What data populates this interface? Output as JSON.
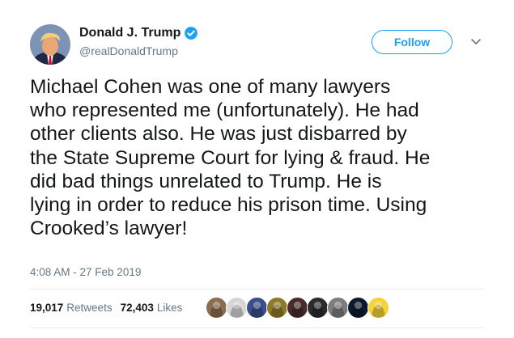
{
  "author": {
    "display_name": "Donald J. Trump",
    "handle": "@realDonaldTrump",
    "verified": true,
    "avatar_icon": "avatar-portrait"
  },
  "actions": {
    "follow_label": "Follow",
    "menu_icon": "chevron-down-icon"
  },
  "tweet": {
    "text": "Michael Cohen was one of many lawyers\nwho represented me (unfortunately). He had\nother clients also. He was just disbarred by\nthe State Supreme Court for lying & fraud. He\ndid bad things unrelated to Trump. He is\nlying in order to reduce his prison time. Using\nCrooked’s lawyer!",
    "timestamp": "4:08 AM - 27 Feb 2019"
  },
  "stats": {
    "retweets_count": "19,017",
    "retweets_label": "Retweets",
    "likes_count": "72,403",
    "likes_label": "Likes"
  },
  "likers": [
    {
      "name": "liker-avatar-dog",
      "color": "#8a6d4e"
    },
    {
      "name": "liker-avatar-face",
      "color": "#d6d6d6"
    },
    {
      "name": "liker-avatar-figure",
      "color": "#3a4f8c"
    },
    {
      "name": "liker-avatar-cartoon",
      "color": "#8c7a2a"
    },
    {
      "name": "liker-avatar-person",
      "color": "#4a2b2b"
    },
    {
      "name": "liker-avatar-portrait",
      "color": "#2b2b2b"
    },
    {
      "name": "liker-avatar-gray",
      "color": "#7d7d7d"
    },
    {
      "name": "liker-avatar-earth",
      "color": "#0d1a2e"
    },
    {
      "name": "liker-avatar-emoji",
      "color": "#f5d33a"
    }
  ],
  "colors": {
    "accent": "#1da1f2",
    "text": "#14171a",
    "muted": "#657786",
    "divider": "#e6ecf0"
  }
}
